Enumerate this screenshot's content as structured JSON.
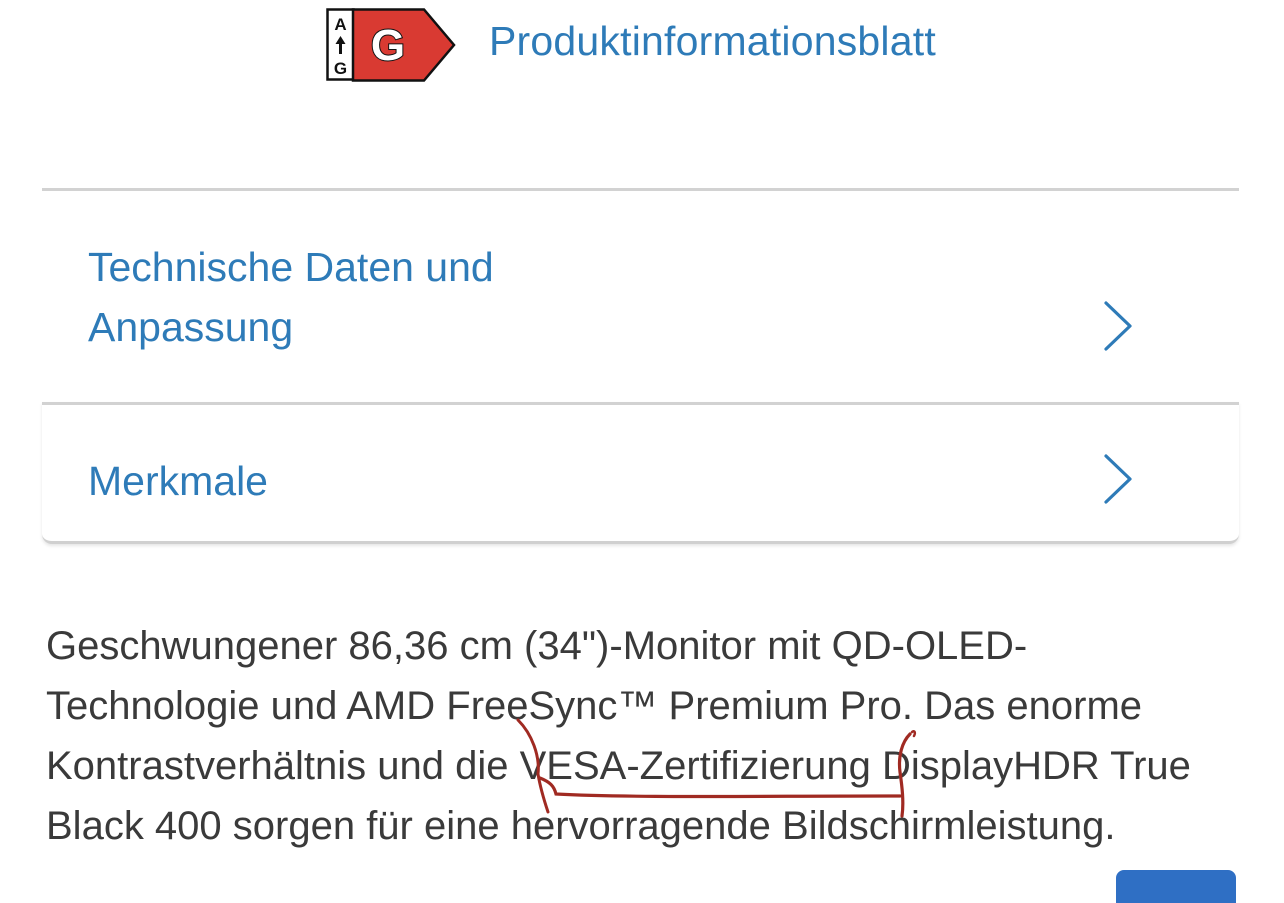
{
  "energy_label": {
    "scale_top": "A",
    "scale_bottom": "G",
    "class": "G",
    "class_color": "#d93a32",
    "link_text": "Produktinformationsblatt"
  },
  "accordion": {
    "items": [
      {
        "label_line1": "Technische Daten und",
        "label_line2": "Anpassung",
        "icon": "chevron-right-icon"
      },
      {
        "label_line1": "Merkmale",
        "icon": "chevron-right-icon"
      }
    ]
  },
  "description": {
    "lines": [
      "Geschwungener 86,36 cm (34\")-Monitor mit QD-OLED-",
      "Technologie und AMD FreeSync™ Premium Pro. Das enorme",
      "Kontrastverhältnis und die VESA-Zertifizierung DisplayHDR True",
      "Black 400 sorgen für eine hervorragende Bildschirmleistung."
    ],
    "annotation_color": "#a02a22"
  },
  "colors": {
    "link": "#2e7bb8",
    "text": "#3a3a3a",
    "button": "#2f6fc4"
  }
}
